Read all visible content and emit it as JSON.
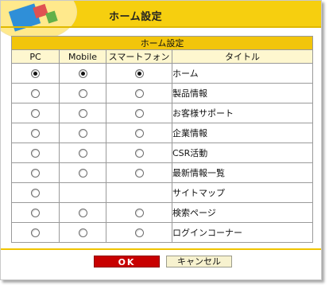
{
  "header": {
    "title": "ホーム設定"
  },
  "table": {
    "caption": "ホーム設定",
    "columns": [
      "PC",
      "Mobile",
      "スマートフォン",
      "タイトル"
    ],
    "rows": [
      {
        "title": "ホーム",
        "pc": "checked",
        "mobile": "checked",
        "smartphone": "checked"
      },
      {
        "title": "製品情報",
        "pc": "unchecked",
        "mobile": "unchecked",
        "smartphone": "unchecked"
      },
      {
        "title": "お客様サポート",
        "pc": "unchecked",
        "mobile": "unchecked",
        "smartphone": "unchecked"
      },
      {
        "title": "企業情報",
        "pc": "unchecked",
        "mobile": "unchecked",
        "smartphone": "unchecked"
      },
      {
        "title": "CSR活動",
        "pc": "unchecked",
        "mobile": "unchecked",
        "smartphone": "unchecked"
      },
      {
        "title": "最新情報一覧",
        "pc": "unchecked",
        "mobile": "unchecked",
        "smartphone": "unchecked"
      },
      {
        "title": "サイトマップ",
        "pc": "unchecked",
        "mobile": null,
        "smartphone": null
      },
      {
        "title": "検索ページ",
        "pc": "unchecked",
        "mobile": "unchecked",
        "smartphone": "unchecked"
      },
      {
        "title": "ログインコーナー",
        "pc": "unchecked",
        "mobile": "unchecked",
        "smartphone": "unchecked"
      }
    ]
  },
  "buttons": {
    "ok": "OK",
    "cancel": "キャンセル"
  },
  "colors": {
    "header": "#f6cf0f",
    "caption_bg": "#f2c50b",
    "column_header_bg": "#fef7cf",
    "ok_button": "#c80000",
    "cancel_button": "#f7f2cf"
  }
}
